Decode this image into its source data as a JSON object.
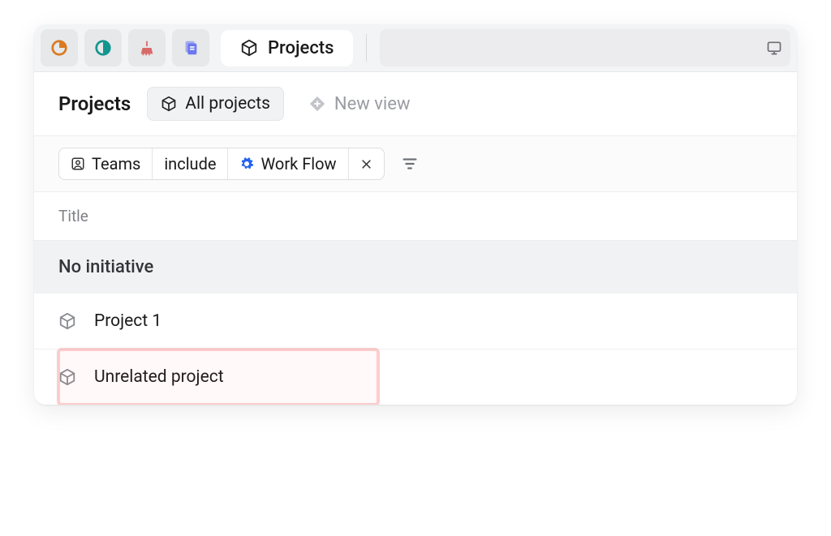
{
  "tabs": {
    "projects_label": "Projects"
  },
  "header": {
    "title": "Projects",
    "all_projects": "All projects",
    "new_view": "New view"
  },
  "filter": {
    "field": "Teams",
    "op": "include",
    "value": "Work Flow"
  },
  "columns": {
    "title": "Title"
  },
  "group": {
    "label": "No initiative"
  },
  "rows": [
    {
      "name": "Project 1",
      "highlight": false
    },
    {
      "name": "Unrelated project",
      "highlight": true
    }
  ],
  "icons": {
    "target": "target-icon",
    "contrast": "contrast-icon",
    "broom": "broom-icon",
    "docs": "docs-icon",
    "box": "box-icon",
    "newview": "diamond-plus-icon",
    "people": "people-icon",
    "gear": "gear-icon",
    "close": "close-icon",
    "filter": "filter-icon",
    "screen": "screen-icon"
  }
}
